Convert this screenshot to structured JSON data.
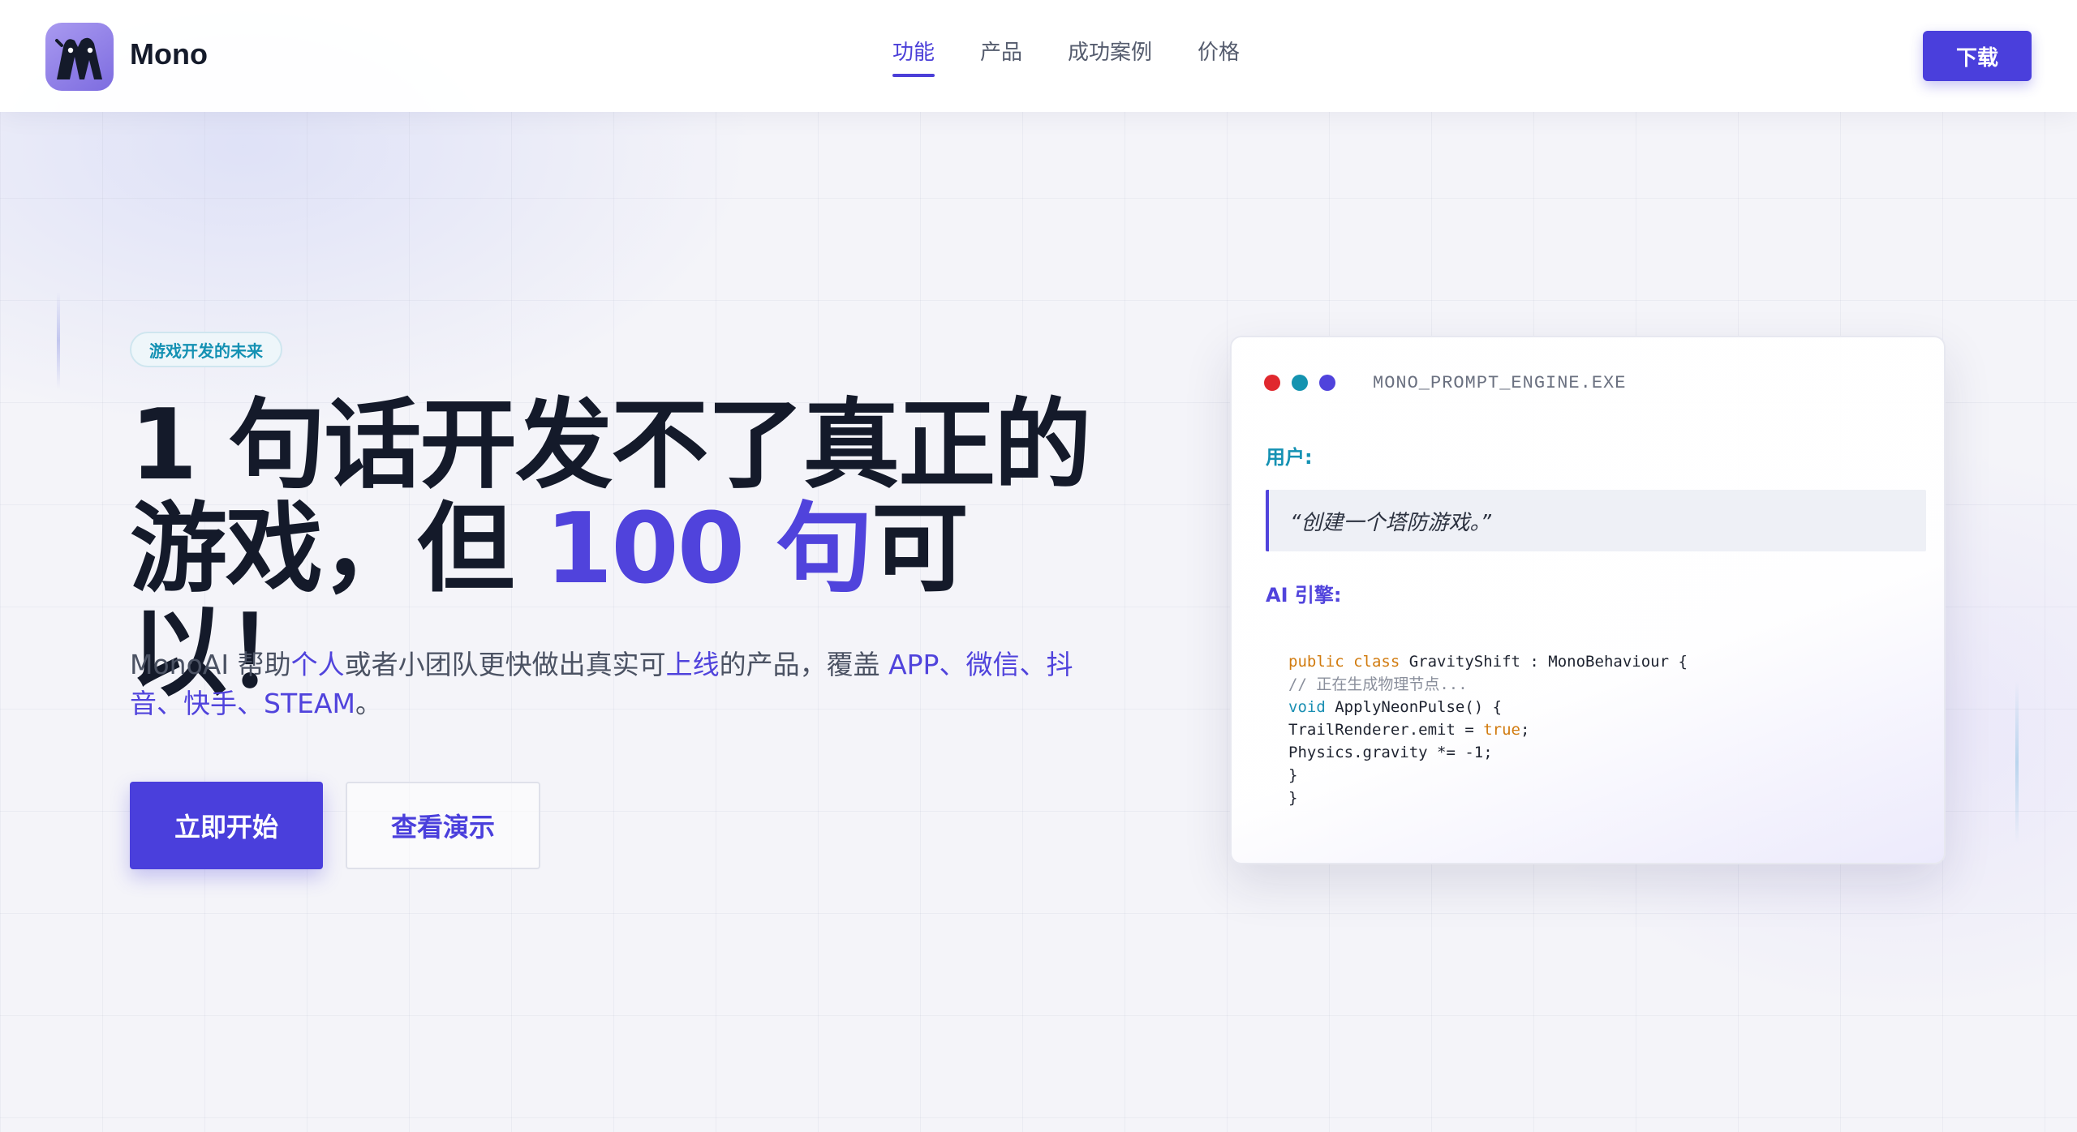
{
  "brand": {
    "name": "Mono",
    "logo_icon": "ghost-characters-icon",
    "logo_color": "#8b7ae6"
  },
  "nav": {
    "items": [
      {
        "label": "功能",
        "active": true
      },
      {
        "label": "产品",
        "active": false
      },
      {
        "label": "成功案例",
        "active": false
      },
      {
        "label": "价格",
        "active": false
      }
    ],
    "download_label": "下载"
  },
  "hero": {
    "tag": "游戏开发的未来",
    "headline_part1": "1 句话开发不了真正的游戏，但 ",
    "headline_highlight": "100 句",
    "headline_part2": "可以！",
    "sub_prefix": "MonoAI 帮助",
    "sub_em1": "个人",
    "sub_mid1": "或者小团队更快做出真实可",
    "sub_em2": "上线",
    "sub_mid2": "的产品，覆盖 ",
    "sub_em3": "APP、微信、抖音、快手、STEAM",
    "sub_suffix": "。",
    "primary_cta": "立即开始",
    "secondary_cta": "查看演示"
  },
  "card": {
    "window_title": "MONO_PROMPT_ENGINE.EXE",
    "dot_colors": [
      "#e0282e",
      "#1493b0",
      "#5043dc"
    ],
    "user_label": "用户:",
    "user_prompt": "“创建一个塔防游戏。”",
    "ai_label": "AI 引擎:",
    "code": {
      "line1_kw": "public class",
      "line1_rest": " GravityShift : MonoBehaviour {",
      "line2": "// 正在生成物理节点...",
      "line3_kw": "void",
      "line3_rest": " ApplyNeonPulse() {",
      "line4_a": "TrailRenderer.emit = ",
      "line4_bool": "true",
      "line4_b": ";",
      "line5": "Physics.gravity *= -1;",
      "line6": "}",
      "line7": "}"
    }
  },
  "colors": {
    "accent": "#4a3fdc",
    "teal": "#1491b3",
    "text_dark": "#141a2a"
  }
}
